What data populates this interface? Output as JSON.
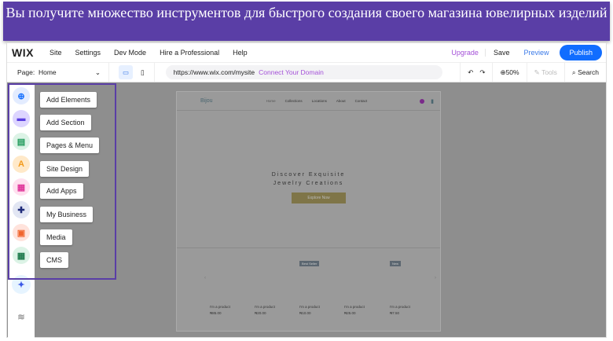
{
  "banner": {
    "text": "Вы получите множество инструментов для быстрого создания своего магазина ювелирных изделий"
  },
  "topbar": {
    "logo": "WIX",
    "menu": [
      "Site",
      "Settings",
      "Dev Mode",
      "Hire a Professional",
      "Help"
    ],
    "upgrade": "Upgrade",
    "save": "Save",
    "preview": "Preview",
    "publish": "Publish"
  },
  "toolbar": {
    "page_label": "Page:",
    "page_value": "Home",
    "url": "https://www.wix.com/mysite",
    "connect": "Connect Your Domain",
    "zoom": "50%",
    "tools": "Tools",
    "search": "Search"
  },
  "sidebar": {
    "items": [
      {
        "label": "Add Elements"
      },
      {
        "label": "Add Section"
      },
      {
        "label": "Pages & Menu"
      },
      {
        "label": "Site Design"
      },
      {
        "label": "Add Apps"
      },
      {
        "label": "My Business"
      },
      {
        "label": "Media"
      },
      {
        "label": "CMS"
      }
    ]
  },
  "site": {
    "brand": "Bijou",
    "nav": [
      "Home",
      "Collections",
      "Locations",
      "About",
      "Contact"
    ],
    "hero_line1": "Discover Exquisite",
    "hero_line2": "Jewelry Creations",
    "cta": "Explore Now",
    "badges": [
      "Best Seller",
      "New"
    ],
    "products": [
      {
        "name": "I'm a product",
        "price": "₦85.00"
      },
      {
        "name": "I'm a product",
        "price": "₦20.00"
      },
      {
        "name": "I'm a product",
        "price": "₦10.00"
      },
      {
        "name": "I'm a product",
        "price": "₦25.00"
      },
      {
        "name": "I'm a product",
        "price": "₦7.50"
      }
    ]
  }
}
